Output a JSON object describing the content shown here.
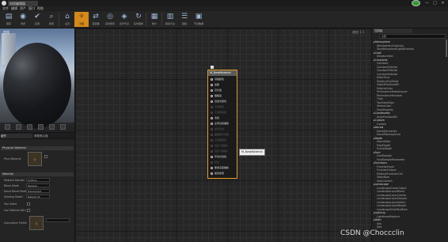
{
  "titlebar": {
    "app_logo_icon": "engine-logo-icon",
    "document_tab": "材质编辑器",
    "online_icon": "online-status-icon",
    "window_controls": [
      "—",
      "□",
      "✕"
    ]
  },
  "menu": [
    "文件",
    "编辑",
    "资产",
    "窗口",
    "帮助"
  ],
  "toolbar": [
    {
      "label": "保存",
      "icon": "save-icon",
      "glyph": "▤"
    },
    {
      "label": "浏览",
      "icon": "browse-icon",
      "glyph": "◉"
    },
    {
      "label": "应用",
      "icon": "apply-icon",
      "glyph": "✔"
    },
    {
      "label": "搜索",
      "icon": "search-icon",
      "glyph": "⌕"
    },
    {
      "label": "主页",
      "icon": "home-icon",
      "glyph": "⌂"
    },
    {
      "label": "清理",
      "icon": "clean-icon",
      "glyph": "✧"
    },
    {
      "label": "连接器",
      "icon": "connectors-icon",
      "glyph": "⇄"
    },
    {
      "label": "实时预览",
      "icon": "live-preview-icon",
      "glyph": "◎"
    },
    {
      "label": "实时节点",
      "icon": "live-nodes-icon",
      "glyph": "◈"
    },
    {
      "label": "实时更新",
      "icon": "live-update-icon",
      "glyph": "↻"
    },
    {
      "label": "统计",
      "icon": "stats-icon",
      "glyph": "▦"
    },
    {
      "label": "移动平台",
      "icon": "platform-stats-icon",
      "glyph": "▥"
    },
    {
      "label": "层级",
      "icon": "hierarchy-icon",
      "glyph": "☰"
    },
    {
      "label": "节点数据",
      "icon": "node-data-icon",
      "glyph": "▣"
    }
  ],
  "toolbar_active_index": 5,
  "viewport": {
    "label": "透视"
  },
  "details": {
    "tabs": [
      "细节",
      "参数默认值"
    ],
    "section_physical": "Physical Material",
    "phys_mat_label": "Phys Material",
    "thumb_none": "无",
    "section_material": "Material",
    "material_domain_label": "Material Domain",
    "material_domain_value": "Surface",
    "blend_mode_label": "Blend Mode",
    "blend_mode_value": "Opaque",
    "decal_blend_label": "Decal Blend Mode",
    "decal_blend_value": "Translucent",
    "shading_model_label": "Shading Model",
    "shading_model_value": "Default Lit",
    "two_sided_label": "Two Sided",
    "use_material_attributes_label": "Use Material Attri...",
    "subsurface_profile_label": "Subsurface Profile"
  },
  "graph": {
    "zoom_label": "缩放 1:1",
    "node_title": "M_NewMaterial",
    "pins": [
      {
        "label": "基础颜色",
        "enabled": true
      },
      {
        "label": "金属",
        "enabled": true
      },
      {
        "label": "高光度",
        "enabled": true
      },
      {
        "label": "粗糙度",
        "enabled": true
      },
      {
        "label": "自发光颜色",
        "enabled": true
      },
      {
        "label": "不透明度",
        "enabled": false
      },
      {
        "label": "不透明蒙版",
        "enabled": false
      },
      {
        "label": "法线",
        "enabled": true
      },
      {
        "label": "全局位移偏移",
        "enabled": true
      },
      {
        "label": "全局位移",
        "enabled": false
      },
      {
        "label": "曲面细分系数",
        "enabled": false
      },
      {
        "label": "次表面颜色",
        "enabled": false
      },
      {
        "label": "自定义数据0",
        "enabled": false
      },
      {
        "label": "自定义数据1",
        "enabled": false
      },
      {
        "label": "环境光遮挡",
        "enabled": true
      },
      {
        "label": "折射",
        "enabled": false
      },
      {
        "label": "像素深度偏移",
        "enabled": true
      },
      {
        "label": "着色模型",
        "enabled": true
      }
    ],
    "tooltip": "M_NewMaterial"
  },
  "palette": {
    "tab": "控制板",
    "search_value": "全部",
    "items": [
      {
        "text": "▸Atmosphere",
        "cat": true
      },
      {
        "text": "AtmosphericFogColor",
        "cat": false
      },
      {
        "text": "SkyAtmosphereLightDirection",
        "cat": false
      },
      {
        "text": "▸Color",
        "cat": true
      },
      {
        "text": "Desaturation",
        "cat": false
      },
      {
        "text": "▸Constants",
        "cat": true
      },
      {
        "text": "Constant",
        "cat": false
      },
      {
        "text": "Constant2Vector",
        "cat": false
      },
      {
        "text": "Constant3Vector",
        "cat": false
      },
      {
        "text": "Constant4Vector",
        "cat": false
      },
      {
        "text": "DeltaTime",
        "cat": false
      },
      {
        "text": "DistanceCullFade",
        "cat": false
      },
      {
        "text": "ObjectPositionWS",
        "cat": false
      },
      {
        "text": "ParticleColor",
        "cat": false
      },
      {
        "text": "PerInstanceFadeAmount",
        "cat": false
      },
      {
        "text": "PerInstanceRandom",
        "cat": false
      },
      {
        "text": "Time",
        "cat": false
      },
      {
        "text": "TwoSidedSign",
        "cat": false
      },
      {
        "text": "VertexColor",
        "cat": false
      },
      {
        "text": "ViewProperty",
        "cat": false
      },
      {
        "text": "▸Coordinates",
        "cat": true
      },
      {
        "text": "ActorPositionWS",
        "cat": false
      },
      {
        "text": "▸Custom",
        "cat": true
      },
      {
        "text": "Custom",
        "cat": false
      },
      {
        "text": "▸Decals",
        "cat": true
      },
      {
        "text": "DecalDerivative",
        "cat": false
      },
      {
        "text": "DecalMipmapLevel",
        "cat": false
      },
      {
        "text": "▸Depth",
        "cat": true
      },
      {
        "text": "DepthFade",
        "cat": false
      },
      {
        "text": "PixelDepth",
        "cat": false
      },
      {
        "text": "SceneDepth",
        "cat": false
      },
      {
        "text": "▸Font",
        "cat": true
      },
      {
        "text": "FontSample",
        "cat": false
      },
      {
        "text": "FontSampleParameter",
        "cat": false
      },
      {
        "text": "▸Functions",
        "cat": true
      },
      {
        "text": "FunctionInput",
        "cat": false
      },
      {
        "text": "FunctionOutput",
        "cat": false
      },
      {
        "text": "MaterialFunctionCall",
        "cat": false
      },
      {
        "text": "StaticBool",
        "cat": false
      },
      {
        "text": "StaticSwitch",
        "cat": false
      },
      {
        "text": "▸Landscape",
        "cat": true
      },
      {
        "text": "LandscapeGrassOutput",
        "cat": false
      },
      {
        "text": "LandscapeLayerBlend",
        "cat": false
      },
      {
        "text": "LandscapeLayerCoords",
        "cat": false
      },
      {
        "text": "LandscapeLayerSample",
        "cat": false
      },
      {
        "text": "LandscapeLayerSwitch",
        "cat": false
      },
      {
        "text": "LandscapeLayerWeight",
        "cat": false
      },
      {
        "text": "LandscapeVisibilityMask",
        "cat": false
      },
      {
        "text": "▸Lighting",
        "cat": true
      },
      {
        "text": "LightmassReplace",
        "cat": false
      },
      {
        "text": "▸Math",
        "cat": true
      },
      {
        "text": "Abs",
        "cat": false
      },
      {
        "text": "Add",
        "cat": false
      }
    ]
  },
  "watermark": "CSDN @Choccclin",
  "colors": {
    "accent": "#e39a1d",
    "toolbar_active": "#d4891a",
    "graph_bg": "#262626"
  }
}
